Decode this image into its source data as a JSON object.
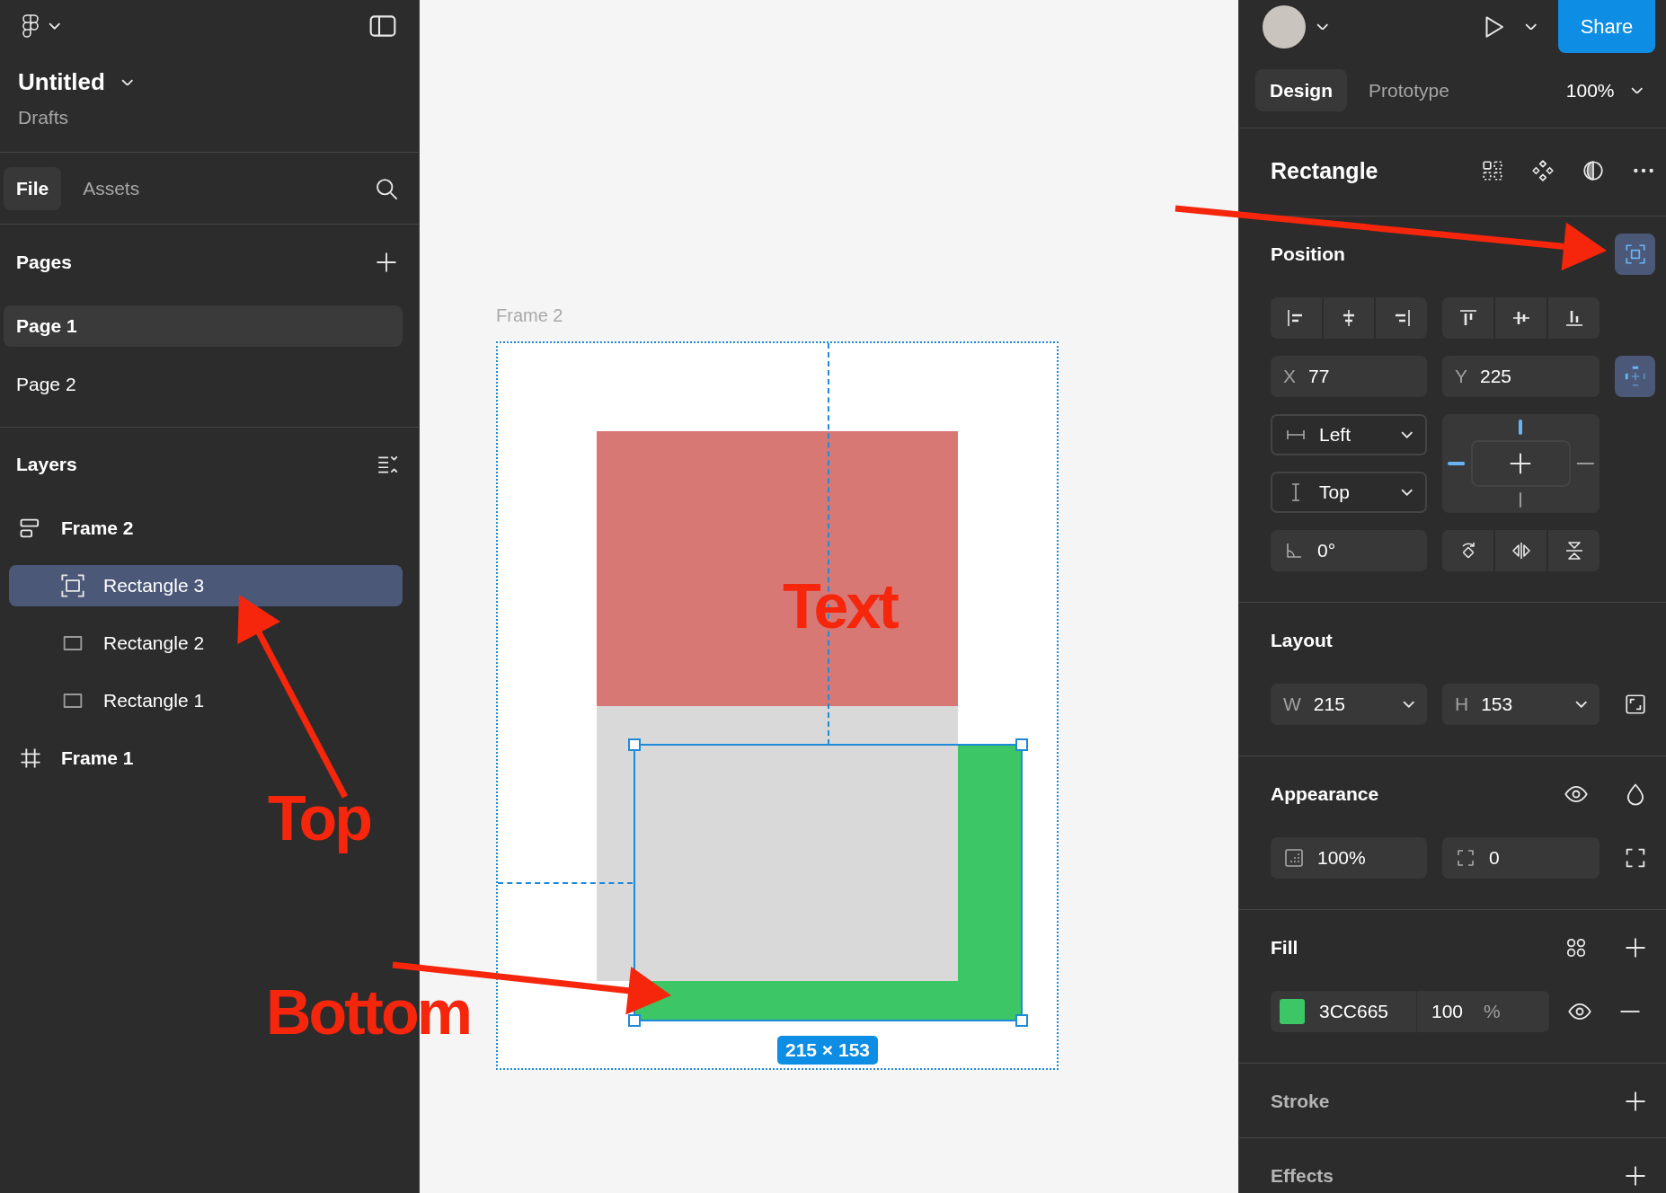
{
  "left_panel": {
    "file_title": "Untitled",
    "file_location": "Drafts",
    "tabs": [
      {
        "label": "File",
        "selected": true
      },
      {
        "label": "Assets",
        "selected": false
      }
    ],
    "pages": {
      "title": "Pages",
      "items": [
        {
          "label": "Page 1",
          "selected": true
        },
        {
          "label": "Page 2",
          "selected": false
        }
      ]
    },
    "layers": {
      "title": "Layers",
      "items": [
        {
          "name": "Frame 2",
          "kind": "autolayout-frame",
          "selected": false,
          "children": [
            {
              "name": "Rectangle 3",
              "kind": "absolute-rectangle",
              "selected": true
            },
            {
              "name": "Rectangle 2",
              "kind": "rectangle",
              "selected": false
            },
            {
              "name": "Rectangle 1",
              "kind": "rectangle",
              "selected": false
            }
          ]
        },
        {
          "name": "Frame 1",
          "kind": "frame",
          "selected": false
        }
      ]
    }
  },
  "canvas": {
    "frame_label": "Frame 2",
    "selection_size": "215 × 153"
  },
  "annotations": [
    {
      "text": "Text"
    },
    {
      "text": "Top"
    },
    {
      "text": "Bottom"
    }
  ],
  "right_panel": {
    "share_label": "Share",
    "tabs": [
      {
        "label": "Design",
        "selected": true
      },
      {
        "label": "Prototype",
        "selected": false
      }
    ],
    "zoom": "100%",
    "selection_title": "Rectangle",
    "position": {
      "title": "Position",
      "absolute_position": true,
      "x": {
        "label": "X",
        "value": "77"
      },
      "y": {
        "label": "Y",
        "value": "225"
      },
      "constraint_panel": true,
      "horizontal_constraint": "Left",
      "vertical_constraint": "Top",
      "constraints": {
        "top": true,
        "left": true,
        "right": false,
        "bottom": false
      },
      "rotation": "0°"
    },
    "layout": {
      "title": "Layout",
      "width": {
        "label": "W",
        "value": "215"
      },
      "height": {
        "label": "H",
        "value": "153"
      }
    },
    "appearance": {
      "title": "Appearance",
      "opacity": "100%",
      "corner_radius": "0"
    },
    "fill": {
      "title": "Fill",
      "fills": [
        {
          "color": "#3cc665",
          "hex": "3CC665",
          "opacity": "100",
          "unit": "%"
        }
      ]
    },
    "stroke": {
      "title": "Stroke",
      "active": false
    },
    "effects": {
      "title": "Effects",
      "active": false
    }
  }
}
